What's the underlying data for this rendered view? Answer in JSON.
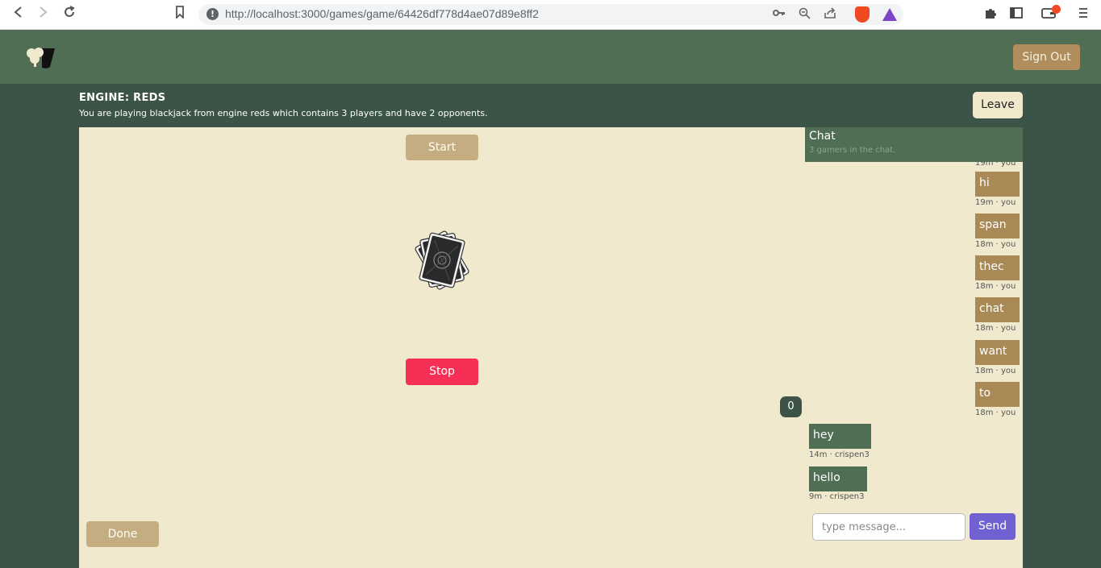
{
  "browser": {
    "url": "http://localhost:3000/games/game/64426df778d4ae07d89e8ff2",
    "icons": {
      "back": "arrow-left-icon",
      "forward": "arrow-right-icon",
      "reload": "reload-icon",
      "bookmark": "bookmark-icon",
      "warning": "not-secure-icon",
      "key": "key-icon",
      "zoom": "zoom-icon",
      "share": "share-icon",
      "brave": "brave-shield-icon",
      "rewards": "brave-rewards-icon",
      "extensions": "puzzle-icon",
      "sidebar": "sidebar-icon",
      "wallet": "wallet-icon",
      "menu": "menu-icon"
    }
  },
  "header": {
    "logo": "clover-spade-logo",
    "signout_label": "Sign Out"
  },
  "game": {
    "engine_title": "ENGINE: REDS",
    "description": "You are playing blackjack from engine reds which contains 3 players and have 2 opponents.",
    "leave_label": "Leave",
    "start_label": "Start",
    "stop_label": "Stop",
    "done_label": "Done",
    "count": "0",
    "deck_icon": "card-deck-icon"
  },
  "chat": {
    "title": "Chat",
    "subtitle": "3 gamers in the chat.",
    "peek_meta": "19m · you",
    "messages": [
      {
        "text": "hi",
        "meta": "19m · you",
        "mine": true
      },
      {
        "text": "span",
        "meta": "18m · you",
        "mine": true
      },
      {
        "text": "thec",
        "meta": "18m · you",
        "mine": true
      },
      {
        "text": "chat",
        "meta": "18m · you",
        "mine": true
      },
      {
        "text": "want",
        "meta": "18m · you",
        "mine": true
      },
      {
        "text": "to",
        "meta": "18m · you",
        "mine": true
      },
      {
        "text": "hey",
        "meta": "14m · crispen3",
        "mine": false
      },
      {
        "text": "hello",
        "meta": "9m · crispen3",
        "mine": false
      }
    ],
    "input_placeholder": "type message...",
    "send_label": "Send"
  },
  "colors": {
    "page_bg": "#3b5447",
    "header_bg": "#506e53",
    "table_bg": "#f0e9cd",
    "gold": "#a98a57",
    "stop_red": "#f62f57",
    "send_purple": "#6f61d1"
  }
}
